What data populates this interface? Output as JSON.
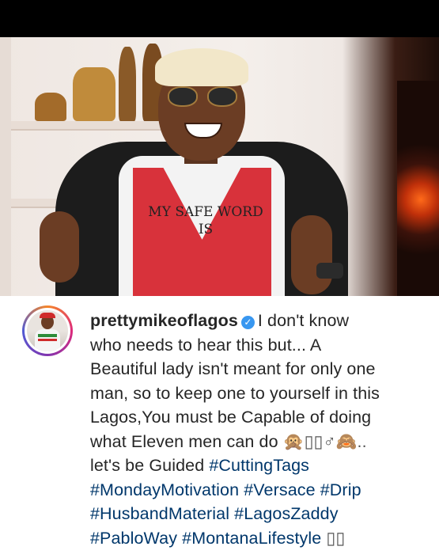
{
  "post": {
    "tshirt_text_line1": "MY SAFE WORD",
    "tshirt_text_line2": "IS"
  },
  "caption": {
    "username": "prettymikeoflagos",
    "verified_icon": "check-icon",
    "body_line1": "I don't know",
    "body_line2": "who needs to hear this but... A",
    "body_line3": "Beautiful lady isn't meant for only one",
    "body_line4": "man, so to keep one to yourself in this",
    "body_line5": "Lagos,You must be Capable of doing",
    "body_line6": "what Eleven men can do",
    "emoji_run1": "🙊▯▯♂🙈..",
    "body_line7": "let's be Guided",
    "hashtags": [
      "#CuttingTags",
      "#MondayMotivation",
      "#Versace",
      "#Drip",
      "#HusbandMaterial",
      "#LagosZaddy",
      "#PabloWay",
      "#MontanaLifestyle"
    ],
    "emoji_run2": "▯▯"
  },
  "colors": {
    "hashtag": "#00376b",
    "verified": "#3897f0",
    "text": "#262626"
  }
}
